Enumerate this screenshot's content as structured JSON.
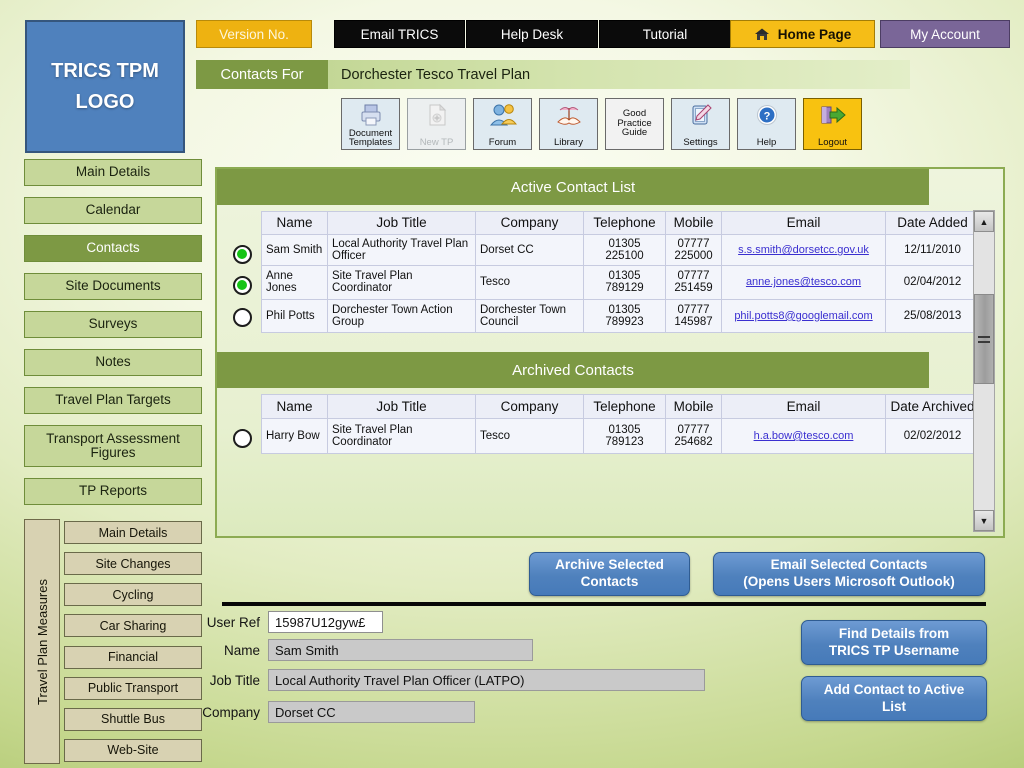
{
  "logo": {
    "line1": "TRICS TPM",
    "line2": "LOGO",
    "color": "#4f81bd"
  },
  "topnav": [
    {
      "label": "Version No.",
      "style": "gold"
    },
    {
      "label": "Email TRICS",
      "style": "black"
    },
    {
      "label": "Help Desk",
      "style": "black"
    },
    {
      "label": "Tutorial",
      "style": "black"
    },
    {
      "label": "Home Page",
      "style": "home",
      "icon": "home-icon"
    },
    {
      "label": "My Account",
      "style": "purple"
    }
  ],
  "context": {
    "label": "Contacts For",
    "value": "Dorchester Tesco Travel Plan"
  },
  "toolbar": [
    {
      "label": "Document Templates",
      "icon": "printer-icon",
      "state": "enabled"
    },
    {
      "label": "New TP",
      "icon": "new-document-icon",
      "state": "disabled"
    },
    {
      "label": "Forum",
      "icon": "people-icon",
      "state": "enabled"
    },
    {
      "label": "Library",
      "icon": "book-icon",
      "state": "enabled"
    },
    {
      "label": "Good Practice Guide",
      "icon": "text-icon",
      "state": "enabled"
    },
    {
      "label": "Settings",
      "icon": "pencil-tablet-icon",
      "state": "enabled"
    },
    {
      "label": "Help",
      "icon": "question-mark-icon",
      "state": "enabled"
    },
    {
      "label": "Logout",
      "icon": "exit-arrow-icon",
      "state": "gold"
    }
  ],
  "sidebar": {
    "items": [
      {
        "label": "Main Details",
        "active": false
      },
      {
        "label": "Calendar",
        "active": false
      },
      {
        "label": "Contacts",
        "active": true
      },
      {
        "label": "Site Documents",
        "active": false
      },
      {
        "label": "Surveys",
        "active": false
      },
      {
        "label": "Notes",
        "active": false
      },
      {
        "label": "Travel Plan Targets",
        "active": false
      },
      {
        "label": "Transport Assessment Figures",
        "active": false
      },
      {
        "label": "TP Reports",
        "active": false
      }
    ],
    "measures_label": "Travel Plan Measures",
    "measures": [
      {
        "label": "Main Details"
      },
      {
        "label": "Site Changes"
      },
      {
        "label": "Cycling"
      },
      {
        "label": "Car Sharing"
      },
      {
        "label": "Financial"
      },
      {
        "label": "Public Transport"
      },
      {
        "label": "Shuttle Bus"
      },
      {
        "label": "Web-Site"
      }
    ]
  },
  "active_list": {
    "title": "Active Contact List",
    "columns": [
      "Name",
      "Job Title",
      "Company",
      "Telephone",
      "Mobile",
      "Email",
      "Date Added"
    ],
    "rows": [
      {
        "selected": true,
        "name": "Sam Smith",
        "job_title": "Local Authority Travel Plan Officer",
        "company": "Dorset CC",
        "telephone": "01305 225100",
        "mobile": "07777 225000",
        "email": "s.s.smith@dorsetcc.gov.uk",
        "date": "12/11/2010"
      },
      {
        "selected": true,
        "name": "Anne Jones",
        "job_title": "Site Travel Plan Coordinator",
        "company": "Tesco",
        "telephone": "01305 789129",
        "mobile": "07777 251459",
        "email": "anne.jones@tesco.com",
        "date": "02/04/2012"
      },
      {
        "selected": false,
        "name": "Phil Potts",
        "job_title": "Dorchester Town Action Group",
        "company": "Dorchester Town Council",
        "telephone": "01305 789923",
        "mobile": "07777 145987",
        "email": "phil.potts8@googlemail.com",
        "date": "25/08/2013"
      }
    ]
  },
  "archived_list": {
    "title": "Archived Contacts",
    "columns": [
      "Name",
      "Job Title",
      "Company",
      "Telephone",
      "Mobile",
      "Email",
      "Date Archived"
    ],
    "rows": [
      {
        "selected": false,
        "name": "Harry Bow",
        "job_title": "Site Travel Plan Coordinator",
        "company": "Tesco",
        "telephone": "01305 789123",
        "mobile": "07777 254682",
        "email": "h.a.bow@tesco.com",
        "date": "02/02/2012"
      }
    ]
  },
  "actions": {
    "archive_line1": "Archive Selected",
    "archive_line2": "Contacts",
    "email_line1": "Email Selected Contacts",
    "email_line2": "(Opens Users Microsoft Outlook)",
    "find_line1": "Find Details from",
    "find_line2": "TRICS TP Username",
    "add_line1": "Add Contact to Active",
    "add_line2": "List"
  },
  "form": {
    "user_ref_label": "User Ref",
    "user_ref_value": "15987U12gyw£",
    "name_label": "Name",
    "name_value": "Sam Smith",
    "job_label": "Job Title",
    "job_value": "Local Authority Travel Plan Officer (LATPO)",
    "company_label": "Company",
    "company_value": "Dorset CC"
  },
  "scrollbar": {
    "up": "▲",
    "down": "▼"
  }
}
